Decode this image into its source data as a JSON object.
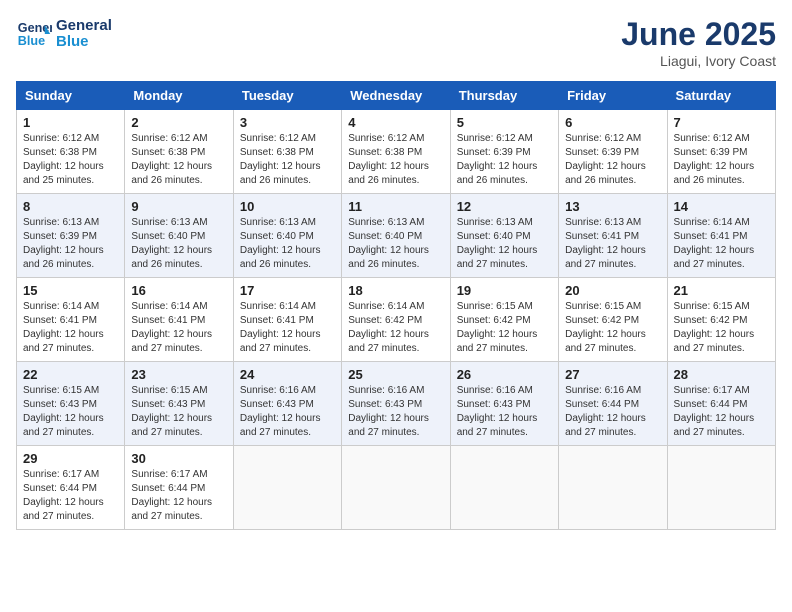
{
  "header": {
    "logo_line1": "General",
    "logo_line2": "Blue",
    "title": "June 2025",
    "subtitle": "Liagui, Ivory Coast"
  },
  "calendar": {
    "days_of_week": [
      "Sunday",
      "Monday",
      "Tuesday",
      "Wednesday",
      "Thursday",
      "Friday",
      "Saturday"
    ],
    "weeks": [
      [
        {
          "day": "1",
          "info": "Sunrise: 6:12 AM\nSunset: 6:38 PM\nDaylight: 12 hours\nand 25 minutes."
        },
        {
          "day": "2",
          "info": "Sunrise: 6:12 AM\nSunset: 6:38 PM\nDaylight: 12 hours\nand 26 minutes."
        },
        {
          "day": "3",
          "info": "Sunrise: 6:12 AM\nSunset: 6:38 PM\nDaylight: 12 hours\nand 26 minutes."
        },
        {
          "day": "4",
          "info": "Sunrise: 6:12 AM\nSunset: 6:38 PM\nDaylight: 12 hours\nand 26 minutes."
        },
        {
          "day": "5",
          "info": "Sunrise: 6:12 AM\nSunset: 6:39 PM\nDaylight: 12 hours\nand 26 minutes."
        },
        {
          "day": "6",
          "info": "Sunrise: 6:12 AM\nSunset: 6:39 PM\nDaylight: 12 hours\nand 26 minutes."
        },
        {
          "day": "7",
          "info": "Sunrise: 6:12 AM\nSunset: 6:39 PM\nDaylight: 12 hours\nand 26 minutes."
        }
      ],
      [
        {
          "day": "8",
          "info": "Sunrise: 6:13 AM\nSunset: 6:39 PM\nDaylight: 12 hours\nand 26 minutes."
        },
        {
          "day": "9",
          "info": "Sunrise: 6:13 AM\nSunset: 6:40 PM\nDaylight: 12 hours\nand 26 minutes."
        },
        {
          "day": "10",
          "info": "Sunrise: 6:13 AM\nSunset: 6:40 PM\nDaylight: 12 hours\nand 26 minutes."
        },
        {
          "day": "11",
          "info": "Sunrise: 6:13 AM\nSunset: 6:40 PM\nDaylight: 12 hours\nand 26 minutes."
        },
        {
          "day": "12",
          "info": "Sunrise: 6:13 AM\nSunset: 6:40 PM\nDaylight: 12 hours\nand 27 minutes."
        },
        {
          "day": "13",
          "info": "Sunrise: 6:13 AM\nSunset: 6:41 PM\nDaylight: 12 hours\nand 27 minutes."
        },
        {
          "day": "14",
          "info": "Sunrise: 6:14 AM\nSunset: 6:41 PM\nDaylight: 12 hours\nand 27 minutes."
        }
      ],
      [
        {
          "day": "15",
          "info": "Sunrise: 6:14 AM\nSunset: 6:41 PM\nDaylight: 12 hours\nand 27 minutes."
        },
        {
          "day": "16",
          "info": "Sunrise: 6:14 AM\nSunset: 6:41 PM\nDaylight: 12 hours\nand 27 minutes."
        },
        {
          "day": "17",
          "info": "Sunrise: 6:14 AM\nSunset: 6:41 PM\nDaylight: 12 hours\nand 27 minutes."
        },
        {
          "day": "18",
          "info": "Sunrise: 6:14 AM\nSunset: 6:42 PM\nDaylight: 12 hours\nand 27 minutes."
        },
        {
          "day": "19",
          "info": "Sunrise: 6:15 AM\nSunset: 6:42 PM\nDaylight: 12 hours\nand 27 minutes."
        },
        {
          "day": "20",
          "info": "Sunrise: 6:15 AM\nSunset: 6:42 PM\nDaylight: 12 hours\nand 27 minutes."
        },
        {
          "day": "21",
          "info": "Sunrise: 6:15 AM\nSunset: 6:42 PM\nDaylight: 12 hours\nand 27 minutes."
        }
      ],
      [
        {
          "day": "22",
          "info": "Sunrise: 6:15 AM\nSunset: 6:43 PM\nDaylight: 12 hours\nand 27 minutes."
        },
        {
          "day": "23",
          "info": "Sunrise: 6:15 AM\nSunset: 6:43 PM\nDaylight: 12 hours\nand 27 minutes."
        },
        {
          "day": "24",
          "info": "Sunrise: 6:16 AM\nSunset: 6:43 PM\nDaylight: 12 hours\nand 27 minutes."
        },
        {
          "day": "25",
          "info": "Sunrise: 6:16 AM\nSunset: 6:43 PM\nDaylight: 12 hours\nand 27 minutes."
        },
        {
          "day": "26",
          "info": "Sunrise: 6:16 AM\nSunset: 6:43 PM\nDaylight: 12 hours\nand 27 minutes."
        },
        {
          "day": "27",
          "info": "Sunrise: 6:16 AM\nSunset: 6:44 PM\nDaylight: 12 hours\nand 27 minutes."
        },
        {
          "day": "28",
          "info": "Sunrise: 6:17 AM\nSunset: 6:44 PM\nDaylight: 12 hours\nand 27 minutes."
        }
      ],
      [
        {
          "day": "29",
          "info": "Sunrise: 6:17 AM\nSunset: 6:44 PM\nDaylight: 12 hours\nand 27 minutes."
        },
        {
          "day": "30",
          "info": "Sunrise: 6:17 AM\nSunset: 6:44 PM\nDaylight: 12 hours\nand 27 minutes."
        },
        {
          "day": "",
          "info": ""
        },
        {
          "day": "",
          "info": ""
        },
        {
          "day": "",
          "info": ""
        },
        {
          "day": "",
          "info": ""
        },
        {
          "day": "",
          "info": ""
        }
      ]
    ]
  }
}
